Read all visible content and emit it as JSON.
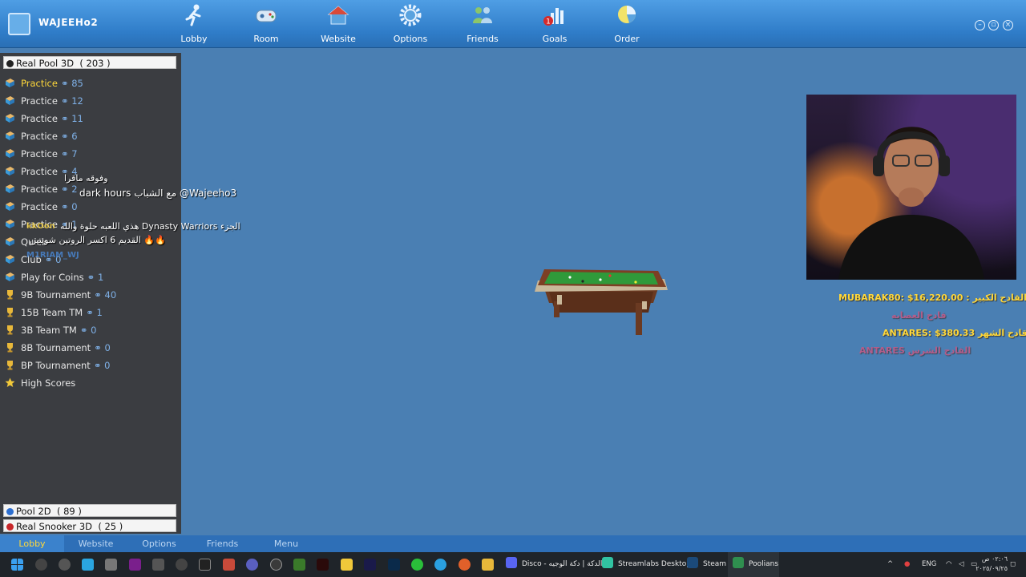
{
  "header": {
    "username": "WAJEEHo2",
    "nav": [
      {
        "id": "lobby",
        "label": "Lobby",
        "icon": "runner-icon"
      },
      {
        "id": "room",
        "label": "Room",
        "icon": "gamepad-icon"
      },
      {
        "id": "website",
        "label": "Website",
        "icon": "house-icon"
      },
      {
        "id": "options",
        "label": "Options",
        "icon": "gear-icon"
      },
      {
        "id": "friends",
        "label": "Friends",
        "icon": "people-icon"
      },
      {
        "id": "goals",
        "label": "Goals",
        "icon": "bar-chart-icon",
        "badge": "1"
      },
      {
        "id": "order",
        "label": "Order",
        "icon": "pie-chart-icon"
      }
    ]
  },
  "sidebar": {
    "section_real_pool": {
      "label": "Real Pool 3D",
      "count": "( 203 )"
    },
    "rooms": [
      {
        "name": "Practice",
        "count": "85",
        "selected": true
      },
      {
        "name": "Practice",
        "count": "12"
      },
      {
        "name": "Practice",
        "count": "11"
      },
      {
        "name": "Practice",
        "count": "6"
      },
      {
        "name": "Practice",
        "count": "7"
      },
      {
        "name": "Practice",
        "count": "4"
      },
      {
        "name": "Practice",
        "count": "2"
      },
      {
        "name": "Practice",
        "count": "0"
      },
      {
        "name": "Practice",
        "count": "1"
      },
      {
        "name": "Quick",
        "count": ""
      },
      {
        "name": "Club",
        "count": "0"
      },
      {
        "name": "Play for Coins",
        "count": "1"
      },
      {
        "name": "9B Tournament",
        "count": "40"
      },
      {
        "name": "15B Team TM",
        "count": "1"
      },
      {
        "name": "3B Team TM",
        "count": "0"
      },
      {
        "name": "8B Tournament",
        "count": "0"
      },
      {
        "name": "BP Tournament",
        "count": "0"
      },
      {
        "name": "High Scores",
        "count": ""
      }
    ],
    "section_pool_2d": {
      "label": "Pool 2D",
      "count": "( 89 )"
    },
    "section_snooker": {
      "label": "Real Snooker 3D",
      "count": "( 25 )"
    }
  },
  "chat_overlay": {
    "line1": "وفوقه ماقرا",
    "line2": "dark hours مع الشباب @Wajeeho3",
    "line3_name": "kkOon",
    "line3": "هذي اللعبه حلوة والله Dynasty Warriors الجزء",
    "line4": "القديم 6 اكسر الروتين شويتين 🔥🔥",
    "name_faint": "M1RIAM_WJ"
  },
  "leaderboard": {
    "row1": "MUBARAK80: $16,220.00 : القادح الكبير",
    "row2": "قادح العصابه",
    "row3": "ANTARES: $380.33 قادح الشهر",
    "row4": "ANTARES القادح الشرس"
  },
  "bottom_tabs": [
    "Lobby",
    "Website",
    "Options",
    "Friends",
    "Menu"
  ],
  "taskbar": {
    "apps": [
      {
        "label": "Disco - الدكة | دكة الوجيه",
        "color": "#5865f2"
      },
      {
        "label": "Streamlabs Desktop",
        "color": "#31c3a2"
      },
      {
        "label": "Steam",
        "color": "#1b4a7a"
      },
      {
        "label": "Poolians",
        "color": "#2f8f4f"
      }
    ],
    "lang": "ENG",
    "time": "٠٢:٠٦ ص",
    "date": "٢٠٢٥/٠٩/٢٥"
  },
  "colors": {
    "accent_yellow": "#ffd83a",
    "count_blue": "#7fb1e8",
    "lb_pink": "#e0507a"
  }
}
